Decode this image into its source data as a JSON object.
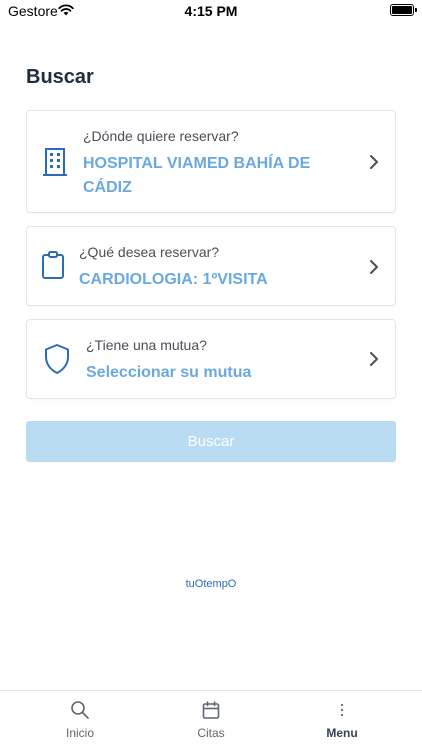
{
  "status": {
    "carrier": "Gestore",
    "time": "4:15 PM"
  },
  "page": {
    "title": "Buscar"
  },
  "cards": {
    "hospital": {
      "question": "¿Dónde quiere reservar?",
      "value_line1": "HOSPITAL VIAMED BAHÍA DE",
      "value_line2": "CÁDIZ"
    },
    "service": {
      "question": "¿Qué desea reservar?",
      "value": "CARDIOLOGIA: 1ºVISITA"
    },
    "insurance": {
      "question": "¿Tiene una mutua?",
      "value": "Seleccionar su mutua"
    }
  },
  "search_button": {
    "label": "Buscar",
    "state": "disabled"
  },
  "brand": {
    "text": "tuOtempO"
  },
  "tabs": [
    {
      "label": "Inicio",
      "icon": "search-icon"
    },
    {
      "label": "Citas",
      "icon": "calendar-icon"
    },
    {
      "label": "Menu",
      "icon": "more-vertical-icon",
      "active": true
    }
  ],
  "colors": {
    "accent": "#2a6db5",
    "value_text": "#6aa9de",
    "button_disabled": "#b9dcf2"
  }
}
